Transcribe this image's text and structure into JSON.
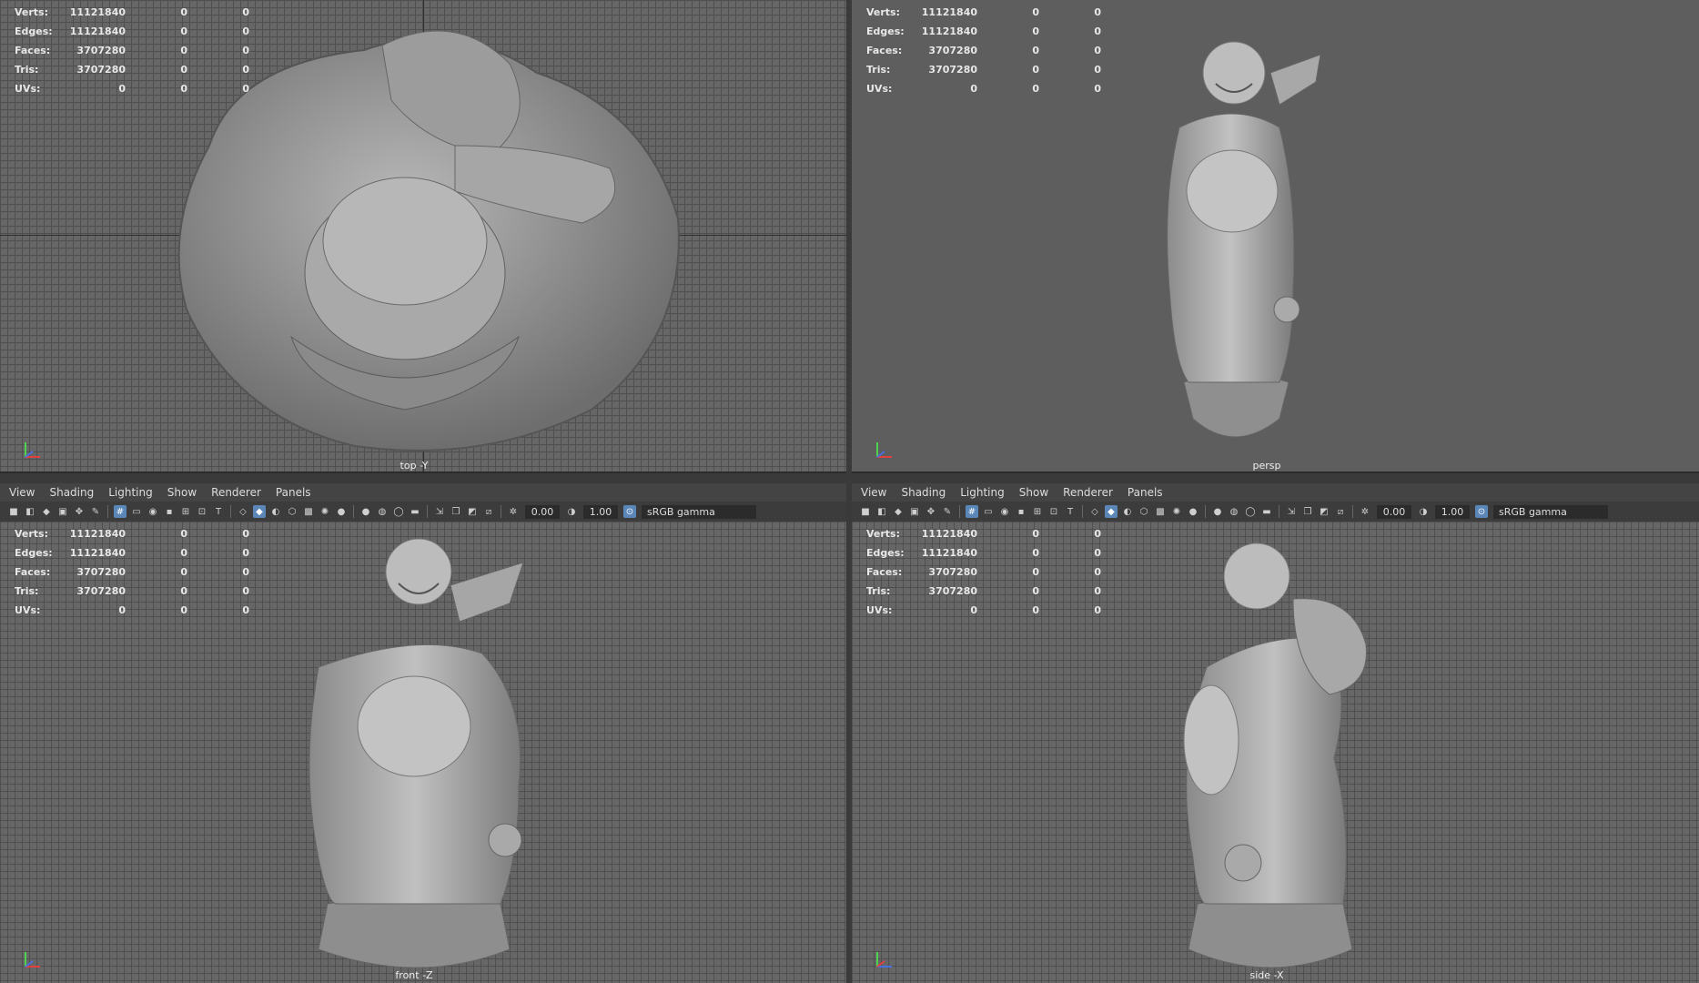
{
  "menu": [
    "View",
    "Shading",
    "Lighting",
    "Show",
    "Renderer",
    "Panels"
  ],
  "toolbar": {
    "field1": "0.00",
    "field2": "1.00",
    "gamma": "sRGB gamma"
  },
  "hud": {
    "labels": [
      "Verts:",
      "Edges:",
      "Faces:",
      "Tris:",
      "UVs:"
    ],
    "col1": [
      "11121840",
      "11121840",
      "3707280",
      "3707280",
      "0"
    ],
    "col2": [
      "0",
      "0",
      "0",
      "0",
      "0"
    ],
    "col3": [
      "0",
      "0",
      "0",
      "0",
      "0"
    ]
  },
  "viewports": {
    "top": "top -Y",
    "persp": "persp",
    "front": "front -Z",
    "side": "side -X"
  },
  "colors": {
    "panel": "#444444",
    "grid": "#666666",
    "persp_bg": "#5e5e5e",
    "highlight": "#5a86b8",
    "model": "#9a9a9a"
  }
}
